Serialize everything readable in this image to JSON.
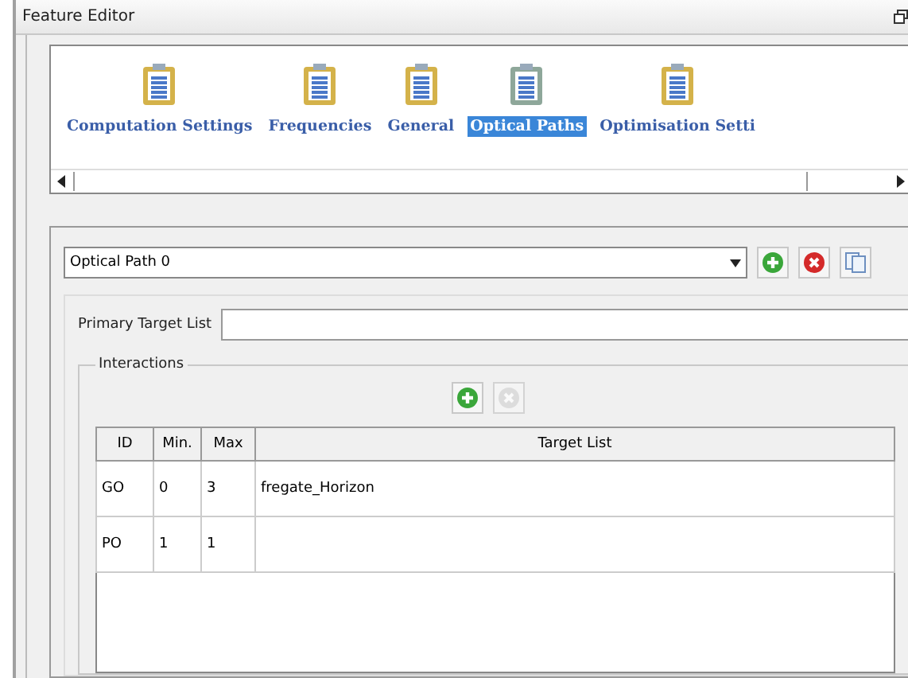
{
  "window": {
    "title": "Feature Editor"
  },
  "tabs": [
    {
      "label": "Computation Settings",
      "selected": false
    },
    {
      "label": "Frequencies",
      "selected": false
    },
    {
      "label": "General",
      "selected": false
    },
    {
      "label": "Optical Paths",
      "selected": true
    },
    {
      "label": "Optimisation Setti",
      "selected": false
    }
  ],
  "path_selector": {
    "value": "Optical Path 0",
    "buttons": [
      {
        "kind": "add",
        "disabled": false
      },
      {
        "kind": "remove",
        "disabled": false
      },
      {
        "kind": "copy",
        "disabled": false
      }
    ]
  },
  "primary_target_list": {
    "label": "Primary Target List"
  },
  "interactions": {
    "title": "Interactions",
    "buttons": [
      {
        "kind": "add",
        "disabled": false
      },
      {
        "kind": "remove",
        "disabled": true
      }
    ],
    "table": {
      "columns": [
        "ID",
        "Min.",
        "Max",
        "Target List"
      ],
      "rows": [
        [
          "GO",
          "0",
          "3",
          "fregate_Horizon"
        ],
        [
          "PO",
          "1",
          "1",
          ""
        ]
      ]
    }
  }
}
